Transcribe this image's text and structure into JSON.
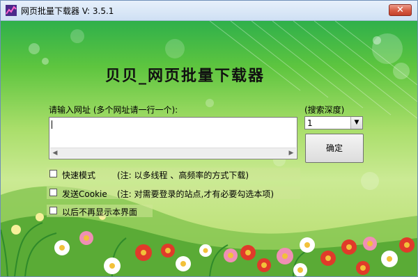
{
  "window": {
    "title": "网页批量下载器 V: 3.5.1",
    "close_symbol": "✕"
  },
  "main": {
    "heading": "贝贝_网页批量下载器",
    "url_label": "请输入网址 (多个网址请一行一个):",
    "url_value": "",
    "depth_label": "(搜索深度)",
    "depth_value": "1",
    "ok_button": "确定",
    "options": [
      {
        "label": "快速模式",
        "note": "(注: 以多线程 、高频率的方式下载)",
        "checked": false
      },
      {
        "label": "发送Cookie",
        "note": "(注: 对需要登录的站点,才有必要勾选本项)",
        "checked": false
      },
      {
        "label": "以后不再显示本界面",
        "note": "",
        "checked": false
      }
    ]
  },
  "icons": [
    "app-logo-icon",
    "close-icon",
    "scroll-left-arrow-icon",
    "scroll-right-arrow-icon",
    "dropdown-arrow-icon"
  ],
  "colors": {
    "sky_top": "#2fb04b",
    "meadow": "#a8d86a",
    "close_button": "#d75a43",
    "flower_red": "#e03a2a",
    "flower_white": "#ffffff"
  }
}
